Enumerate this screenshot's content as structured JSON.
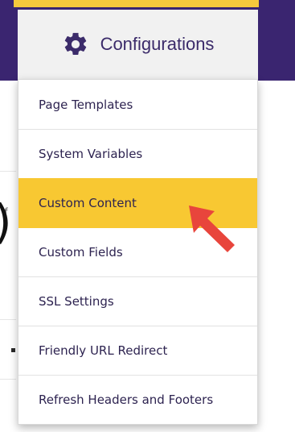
{
  "config_button": {
    "label": "Configurations",
    "icon": "gear-icon"
  },
  "menu": {
    "items": [
      {
        "label": "Page Templates",
        "active": false
      },
      {
        "label": "System Variables",
        "active": false
      },
      {
        "label": "Custom Content",
        "active": true
      },
      {
        "label": "Custom Fields",
        "active": false
      },
      {
        "label": "SSL Settings",
        "active": false
      },
      {
        "label": "Friendly URL Redirect",
        "active": false
      },
      {
        "label": "Refresh Headers and Footers",
        "active": false
      }
    ]
  },
  "background_fragments": {
    "left_text": "if"
  },
  "colors": {
    "header": "#3a2570",
    "accent_yellow": "#f6c93c",
    "active_item": "#f8c832",
    "menu_text": "#2d2350",
    "arrow": "#e8453c"
  }
}
